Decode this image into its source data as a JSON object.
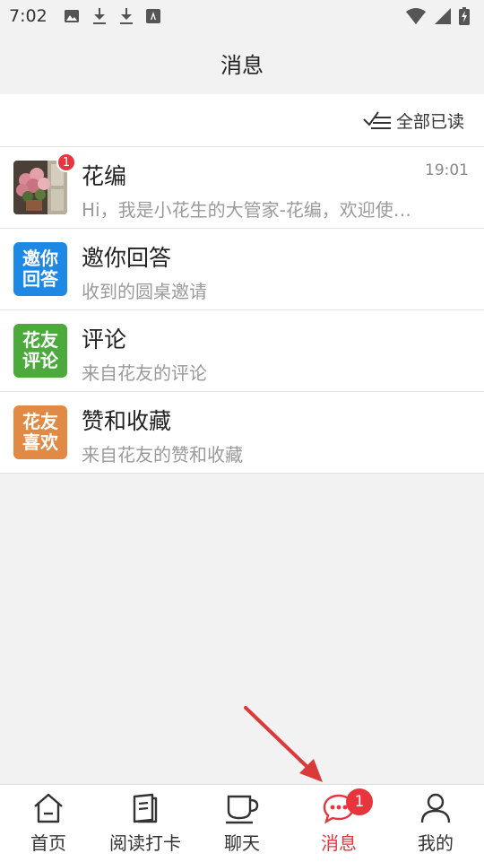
{
  "status_bar": {
    "time": "7:02",
    "icons": [
      "image-icon",
      "download-icon",
      "download-icon",
      "font-icon"
    ],
    "right_icons": [
      "wifi-icon",
      "signal-icon",
      "battery-charging-icon"
    ]
  },
  "header": {
    "title": "消息"
  },
  "toolbar": {
    "mark_all_read": "全部已读",
    "icon": "check-lines-icon"
  },
  "messages": [
    {
      "title": "花编",
      "subtitle": "Hi，我是小花生的大管家-花编，欢迎使用小花生！",
      "time": "19:01",
      "badge": "1",
      "icon": "flower-avatar"
    },
    {
      "title": "邀你回答",
      "subtitle": "收到的圆桌邀请",
      "icon_text": [
        "邀你",
        "回答"
      ],
      "color": "#1e88e5"
    },
    {
      "title": "评论",
      "subtitle": "来自花友的评论",
      "icon_text": [
        "花友",
        "评论"
      ],
      "color": "#4caa3c"
    },
    {
      "title": "赞和收藏",
      "subtitle": "来自花友的赞和收藏",
      "icon_text": [
        "花友",
        "喜欢"
      ],
      "color": "#e08a45"
    }
  ],
  "tabbar": {
    "tabs": [
      {
        "label": "首页",
        "icon": "home-icon"
      },
      {
        "label": "阅读打卡",
        "icon": "book-icon"
      },
      {
        "label": "聊天",
        "icon": "cup-icon"
      },
      {
        "label": "消息",
        "icon": "chat-bubble-icon",
        "badge": "1",
        "active": true
      },
      {
        "label": "我的",
        "icon": "person-icon"
      }
    ]
  },
  "colors": {
    "accent": "#e8343d",
    "annotation_arrow": "#d93a3a"
  }
}
